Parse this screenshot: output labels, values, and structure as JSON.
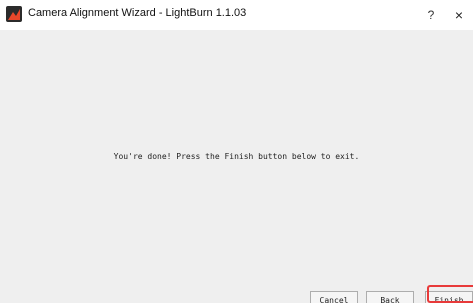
{
  "window": {
    "title": "Camera Alignment Wizard - LightBurn 1.1.03",
    "help_label": "?",
    "close_label": "×"
  },
  "wizard": {
    "message": "You're done!  Press the Finish button below to exit."
  },
  "buttons": {
    "cancel": "Cancel",
    "back": "Back",
    "finish": "Finish"
  },
  "colors": {
    "highlight": "#e83a3a",
    "background": "#efefef"
  }
}
